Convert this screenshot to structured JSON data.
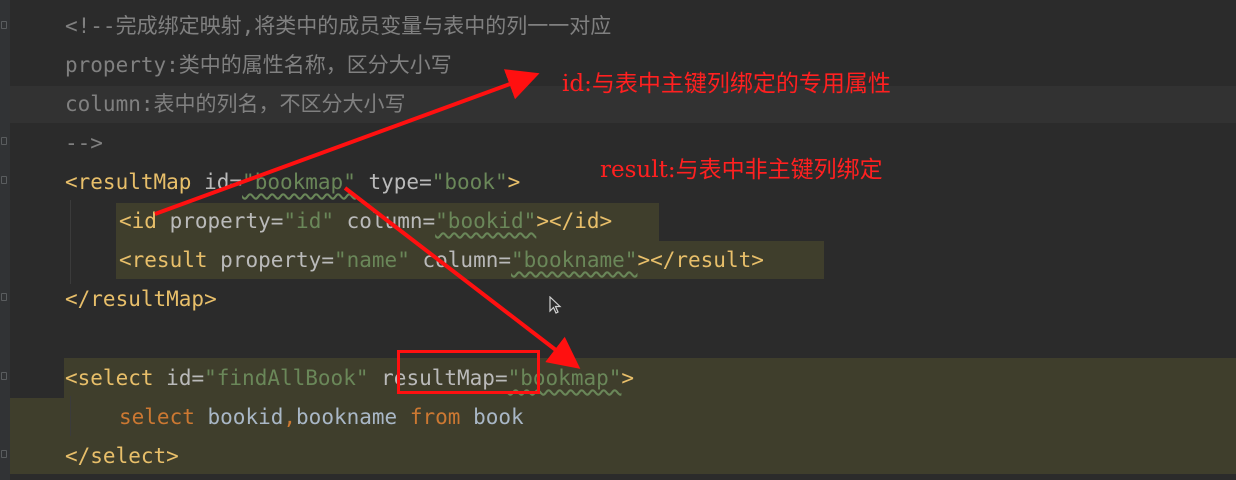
{
  "code": {
    "l1_comment": "<!--完成绑定映射,将类中的成员变量与表中的列一一对应",
    "l2_name": "property",
    "l2_desc": ":类中的属性名称，区分大小写",
    "l3_name": "column",
    "l3_desc": ":表中的列名，不区分大小写",
    "l4_close": "-->",
    "l5": {
      "open": "<resultMap",
      "id_attr": "id",
      "eq": "=",
      "id_val": "\"bookmap\"",
      "type_attr": "type",
      "type_val": "\"book\"",
      "gt": ">"
    },
    "l6": {
      "open": "<id",
      "prop_attr": "property",
      "eq": "=",
      "prop_val": "\"id\"",
      "col_attr": "column",
      "col_val": "\"bookid\"",
      "close": "></id>"
    },
    "l7": {
      "open": "<result",
      "prop_attr": "property",
      "eq": "=",
      "prop_val": "\"name\"",
      "col_attr": "column",
      "col_val": "\"bookname\"",
      "close": "></result>"
    },
    "l8_close": "</resultMap>",
    "l10": {
      "open": "<select",
      "id_attr": "id",
      "eq": "=",
      "id_val": "\"findAllBook\"",
      "rm_attr": "resultMap",
      "rm_val": "\"bookmap\"",
      "gt": ">"
    },
    "l11": {
      "kw_select": "select",
      "cols": "bookid",
      "comma": ",",
      "cols2": "bookname",
      "kw_from": "from",
      "table": "book"
    },
    "l12_close": "</select>"
  },
  "annotations": {
    "id_note": "id:与表中主键列绑定的专用属性",
    "result_note": "result:与表中非主键列绑定"
  },
  "colors": {
    "background": "#2b2b2b",
    "gutter": "#313335",
    "comment": "#808080",
    "tag": "#e8bf6a",
    "attribute": "#bababa",
    "value": "#6a8759",
    "keyword": "#cc7832",
    "text": "#a9b7c6",
    "annotation_red": "#ff2020",
    "highlight_block": "#3f3e2c"
  },
  "icons": {
    "mouse_cursor": "mouse-cursor-icon",
    "arrow": "red-arrow-icon",
    "fold_marker": "fold-marker-icon"
  }
}
